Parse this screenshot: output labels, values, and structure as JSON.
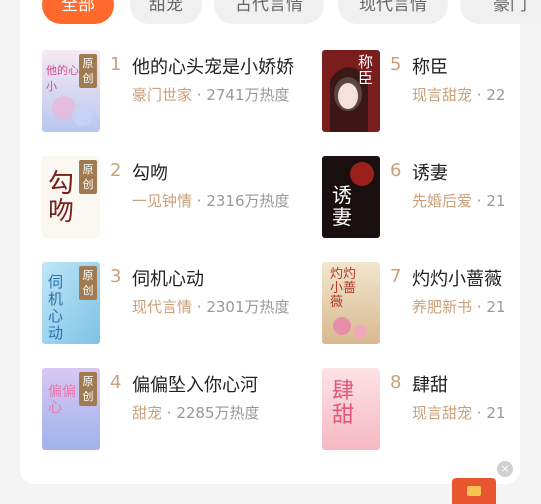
{
  "tabs": [
    {
      "label": "全部"
    },
    {
      "label": "甜宠"
    },
    {
      "label": "古代言情"
    },
    {
      "label": "现代言情"
    },
    {
      "label": "豪门"
    }
  ],
  "badge_label": "原创",
  "books": [
    {
      "rank": "1",
      "title": "他的心头宠是小娇娇",
      "category": "豪门世家",
      "heat": "2741万热度",
      "cover_text": "他的心是小"
    },
    {
      "rank": "2",
      "title": "勾吻",
      "category": "一见钟情",
      "heat": "2316万热度",
      "cover_text": "勾吻"
    },
    {
      "rank": "3",
      "title": "伺机心动",
      "category": "现代言情",
      "heat": "2301万热度",
      "cover_text": "伺机心动"
    },
    {
      "rank": "4",
      "title": "偏偏坠入你心河",
      "category": "甜宠",
      "heat": "2285万热度",
      "cover_text": "偏偏心"
    },
    {
      "rank": "5",
      "title": "称臣",
      "category": "现言甜宠",
      "heat": "22",
      "cover_text": "称臣"
    },
    {
      "rank": "6",
      "title": "诱妻",
      "category": "先婚后爱",
      "heat": "21",
      "cover_text": "诱妻"
    },
    {
      "rank": "7",
      "title": "灼灼小蔷薇",
      "category": "养肥新书",
      "heat": "21",
      "cover_text": "灼灼小蔷薇"
    },
    {
      "rank": "8",
      "title": "肆甜",
      "category": "现言甜宠",
      "heat": "21",
      "cover_text": "肆甜"
    }
  ],
  "meta_separator": " · ",
  "close_glyph": "×",
  "colors": {
    "accent": "#ff6a2c",
    "category": "#c9a07a",
    "badge": "#a07b52"
  }
}
